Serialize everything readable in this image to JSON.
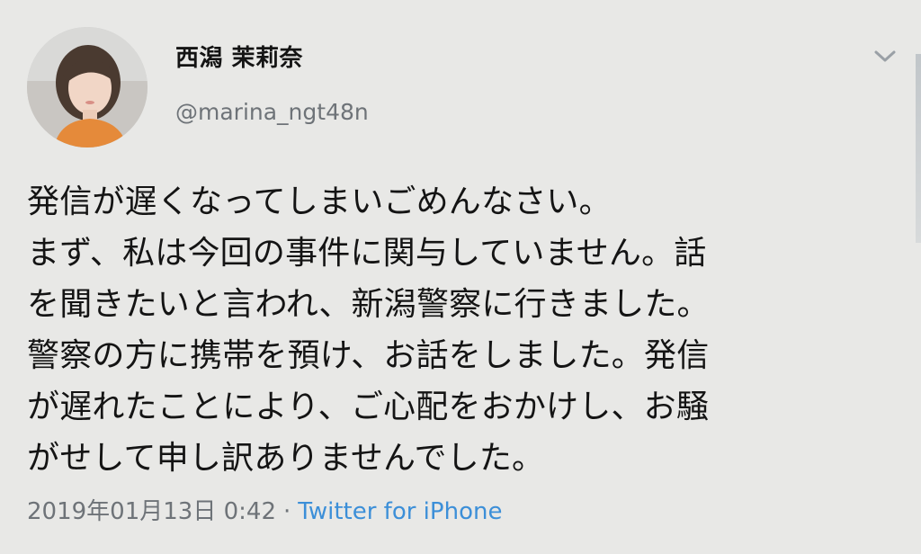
{
  "user": {
    "display_name": "西潟 茉莉奈",
    "handle": "@marina_ngt48n"
  },
  "icons": {
    "menu": "chevron-down-icon",
    "avatar": "profile-photo"
  },
  "tweet": {
    "lines": [
      "発信が遅くなってしまいごめんなさい。",
      "まず、私は今回の事件に関与していません。話",
      "を聞きたいと言われ、新潟警察に行きました。",
      "警察の方に携帯を預け、お話をしました。発信",
      "が遅れたことにより、ご心配をおかけし、お騒",
      "がせして申し訳ありませんでした。"
    ]
  },
  "meta": {
    "datetime": "2019年01月13日 0:42",
    "separator": "·",
    "source": "Twitter for iPhone"
  },
  "colors": {
    "background": "#e8e8e6",
    "secondary_text": "#6e7378",
    "link": "#3c8fd8"
  }
}
